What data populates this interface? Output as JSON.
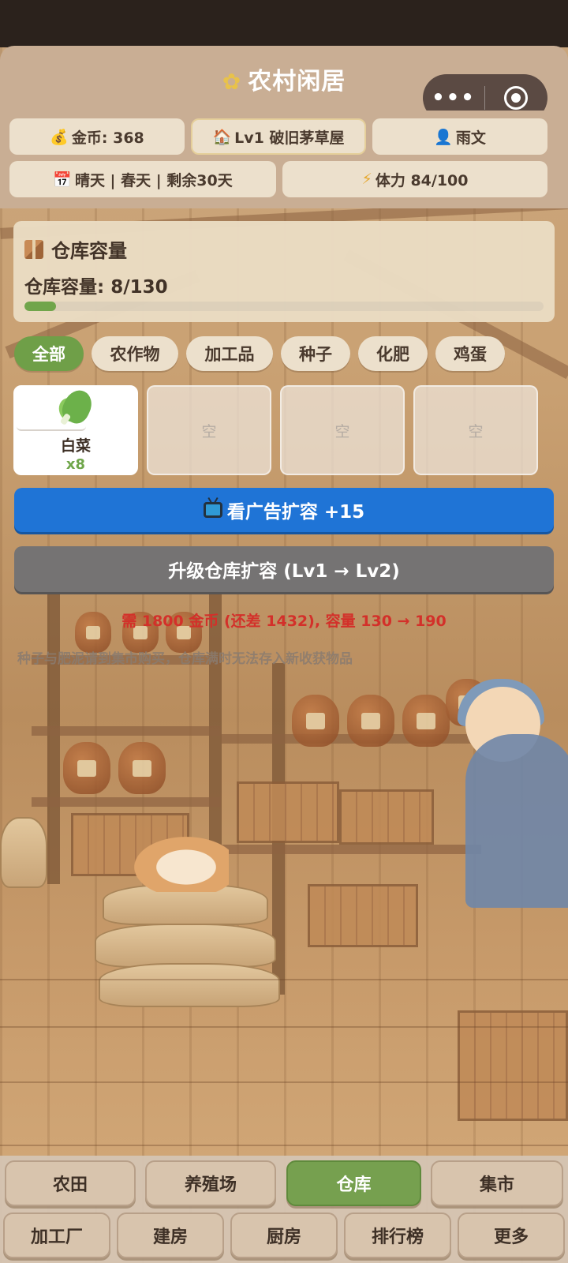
{
  "app": {
    "title": "农村闲居",
    "title_icon": "corn-icon"
  },
  "capsule": {
    "more_label": "•••"
  },
  "stats": {
    "gold": "金币: 368",
    "house": "Lv1 破旧茅草屋",
    "user": "雨文",
    "weather": "晴天 | 春天 | 剩余30天",
    "stamina": "体力 84/100"
  },
  "icons": {
    "gold": "money-bag-icon",
    "house": "house-icon",
    "user": "person-icon",
    "weather": "calendar-icon",
    "stamina": "lightning-icon"
  },
  "warehouse": {
    "title": "仓库容量",
    "capacity_text": "仓库容量: 8/130",
    "used": 8,
    "total": 130
  },
  "filters": [
    "全部",
    "农作物",
    "加工品",
    "种子",
    "化肥",
    "鸡蛋"
  ],
  "active_filter": 0,
  "slots": [
    {
      "name": "白菜",
      "qty": "x8",
      "icon": "cabbage-icon"
    },
    {
      "empty_label": "空"
    },
    {
      "empty_label": "空"
    },
    {
      "empty_label": "空"
    }
  ],
  "buttons": {
    "ad_expand": "看广告扩容 +15",
    "upgrade": "升级仓库扩容 (Lv1 → Lv2)"
  },
  "upgrade_requirement": "需 1800 金币 (还差 1432), 容量 130 → 190",
  "hint": "种子与肥泥请到集市购买，仓库满时无法存入新收获物品",
  "nav": {
    "row1": [
      "农田",
      "养殖场",
      "仓库",
      "集市"
    ],
    "row2": [
      "加工厂",
      "建房",
      "厨房",
      "排行榜",
      "更多"
    ],
    "active": "仓库"
  },
  "colors": {
    "accent_green": "#6f9f48",
    "ad_blue": "#1f74d6",
    "upgrade_gray": "#757373",
    "warning_red": "#d3302a"
  }
}
